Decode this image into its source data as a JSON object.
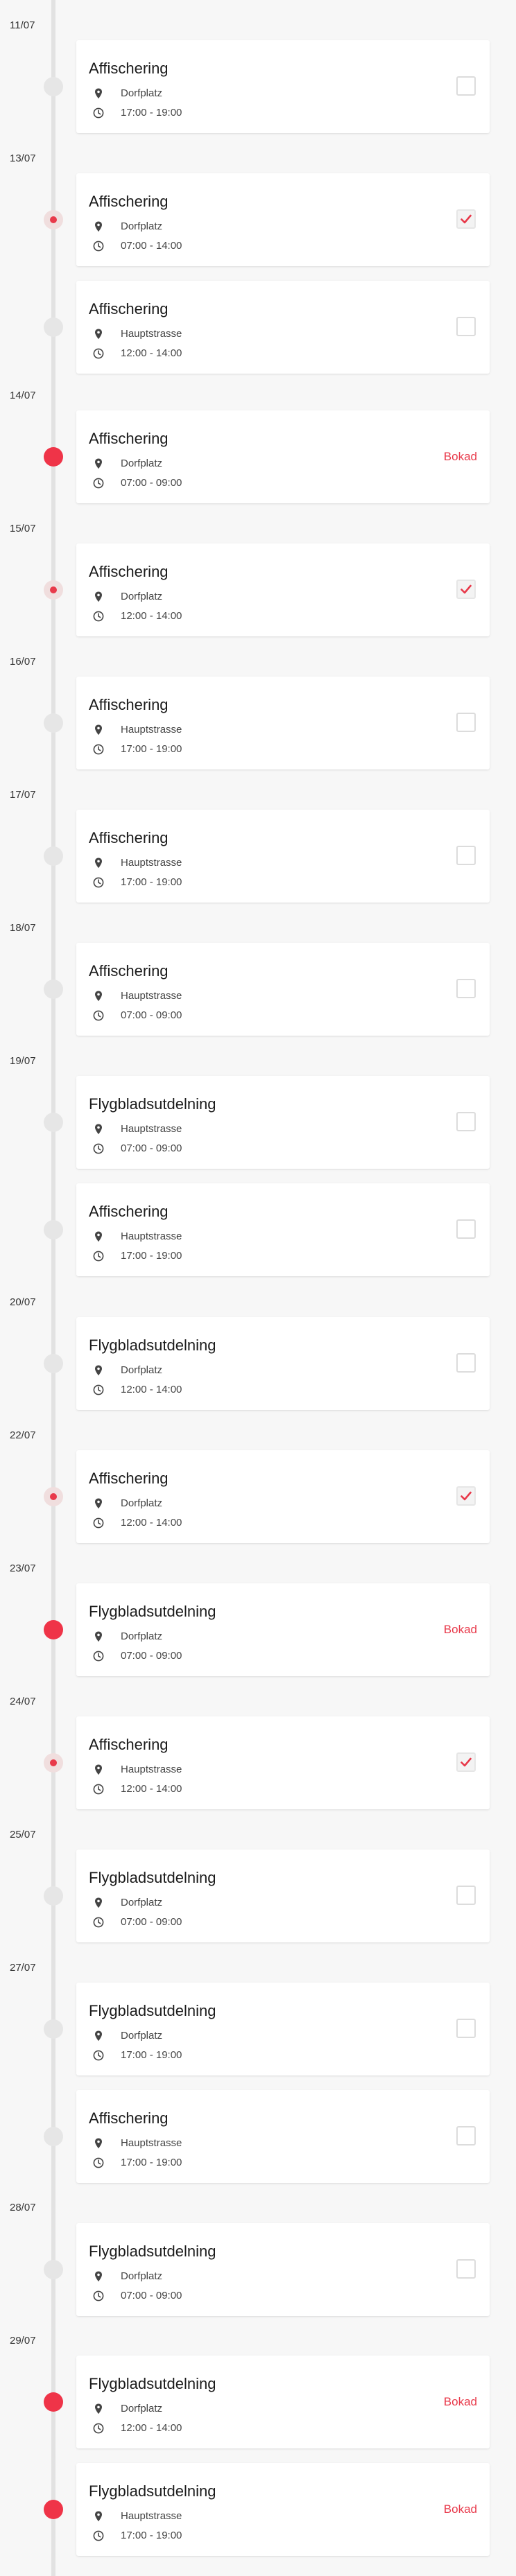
{
  "colors": {
    "accent": "#e8394a",
    "timeline": "#e2e2e2",
    "card": "#ffffff"
  },
  "dates": [
    "11/07",
    "13/07",
    "14/07",
    "15/07",
    "16/07",
    "17/07",
    "18/07",
    "19/07",
    "20/07",
    "22/07",
    "23/07",
    "24/07",
    "25/07",
    "27/07",
    "28/07",
    "29/07"
  ],
  "events": [
    {
      "title": "Affischering",
      "location": "Dorfplatz",
      "time": "17:00 - 19:00",
      "status": "open"
    },
    {
      "title": "Affischering",
      "location": "Dorfplatz",
      "time": "07:00 - 14:00",
      "status": "checked"
    },
    {
      "title": "Affischering",
      "location": "Hauptstrasse",
      "time": "12:00 - 14:00",
      "status": "open"
    },
    {
      "title": "Affischering",
      "location": "Dorfplatz",
      "time": "07:00 - 09:00",
      "status": "booked",
      "booked_label": "Bokad"
    },
    {
      "title": "Affischering",
      "location": "Dorfplatz",
      "time": "12:00 - 14:00",
      "status": "checked"
    },
    {
      "title": "Affischering",
      "location": "Hauptstrasse",
      "time": "17:00 - 19:00",
      "status": "open"
    },
    {
      "title": "Affischering",
      "location": "Hauptstrasse",
      "time": "17:00 - 19:00",
      "status": "open"
    },
    {
      "title": "Affischering",
      "location": "Hauptstrasse",
      "time": "07:00 - 09:00",
      "status": "open"
    },
    {
      "title": "Flygbladsutdelning",
      "location": "Hauptstrasse",
      "time": "07:00 - 09:00",
      "status": "open"
    },
    {
      "title": "Affischering",
      "location": "Hauptstrasse",
      "time": "17:00 - 19:00",
      "status": "open"
    },
    {
      "title": "Flygbladsutdelning",
      "location": "Dorfplatz",
      "time": "12:00 - 14:00",
      "status": "open"
    },
    {
      "title": "Affischering",
      "location": "Dorfplatz",
      "time": "12:00 - 14:00",
      "status": "checked"
    },
    {
      "title": "Flygbladsutdelning",
      "location": "Dorfplatz",
      "time": "07:00 - 09:00",
      "status": "booked",
      "booked_label": "Bokad"
    },
    {
      "title": "Affischering",
      "location": "Hauptstrasse",
      "time": "12:00 - 14:00",
      "status": "checked"
    },
    {
      "title": "Flygbladsutdelning",
      "location": "Dorfplatz",
      "time": "07:00 - 09:00",
      "status": "open"
    },
    {
      "title": "Flygbladsutdelning",
      "location": "Dorfplatz",
      "time": "17:00 - 19:00",
      "status": "open"
    },
    {
      "title": "Affischering",
      "location": "Hauptstrasse",
      "time": "17:00 - 19:00",
      "status": "open"
    },
    {
      "title": "Flygbladsutdelning",
      "location": "Dorfplatz",
      "time": "07:00 - 09:00",
      "status": "open"
    },
    {
      "title": "Flygbladsutdelning",
      "location": "Dorfplatz",
      "time": "12:00 - 14:00",
      "status": "booked",
      "booked_label": "Bokad"
    },
    {
      "title": "Flygbladsutdelning",
      "location": "Hauptstrasse",
      "time": "17:00 - 19:00",
      "status": "booked",
      "booked_label": "Bokad"
    }
  ],
  "icons": {
    "location": "map-pin-icon",
    "time": "clock-icon",
    "check": "checkmark-icon"
  }
}
